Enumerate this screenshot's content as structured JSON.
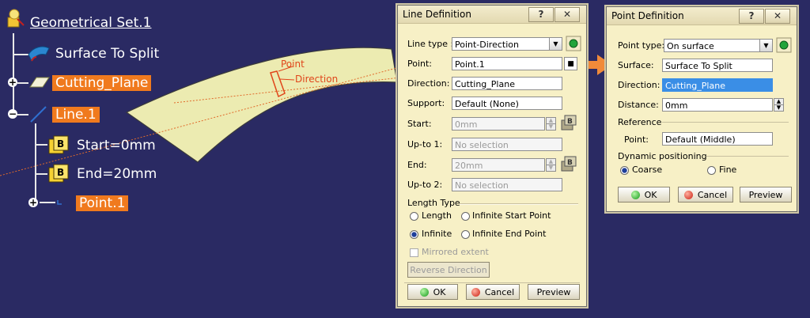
{
  "tree": {
    "root": "Geometrical Set.1",
    "surface": "Surface To Split",
    "plane": "Cutting_Plane",
    "line": "Line.1",
    "start": "Start=0mm",
    "end": "End=20mm",
    "point": "Point.1"
  },
  "viewport": {
    "point_label": "Point",
    "direction_label": "Direction"
  },
  "line_dialog": {
    "title": "Line Definition",
    "help": "?",
    "close": "✕",
    "line_type_label": "Line type :",
    "line_type_value": "Point-Direction",
    "point_label": "Point:",
    "point_value": "Point.1",
    "direction_label": "Direction:",
    "direction_value": "Cutting_Plane",
    "support_label": "Support:",
    "support_value": "Default (None)",
    "start_label": "Start:",
    "start_value": "0mm",
    "upto1_label": "Up-to 1:",
    "upto1_value": "No selection",
    "end_label": "End:",
    "end_value": "20mm",
    "upto2_label": "Up-to 2:",
    "upto2_value": "No selection",
    "length_type_label": "Length Type",
    "opt_length": "Length",
    "opt_infinite_start": "Infinite Start Point",
    "opt_infinite": "Infinite",
    "opt_infinite_end": "Infinite End Point",
    "mirrored_label": "Mirrored extent",
    "reverse_label": "Reverse Direction",
    "ok": "OK",
    "cancel": "Cancel",
    "preview": "Preview"
  },
  "point_dialog": {
    "title": "Point Definition",
    "help": "?",
    "close": "✕",
    "point_type_label": "Point type:",
    "point_type_value": "On surface",
    "surface_label": "Surface:",
    "surface_value": "Surface To Split",
    "direction_label": "Direction:",
    "direction_value": "Cutting_Plane",
    "distance_label": "Distance:",
    "distance_value": "0mm",
    "reference_label": "Reference",
    "ref_point_label": "Point:",
    "ref_point_value": "Default (Middle)",
    "dynamic_label": "Dynamic positioning",
    "coarse": "Coarse",
    "fine": "Fine",
    "ok": "OK",
    "cancel": "Cancel",
    "preview": "Preview"
  },
  "colors": {
    "background": "#2a2a63",
    "highlight": "#f07a1e",
    "surface": "#f0f0b0",
    "annotation": "#e0451a",
    "dialog": "#f7f0c6"
  }
}
